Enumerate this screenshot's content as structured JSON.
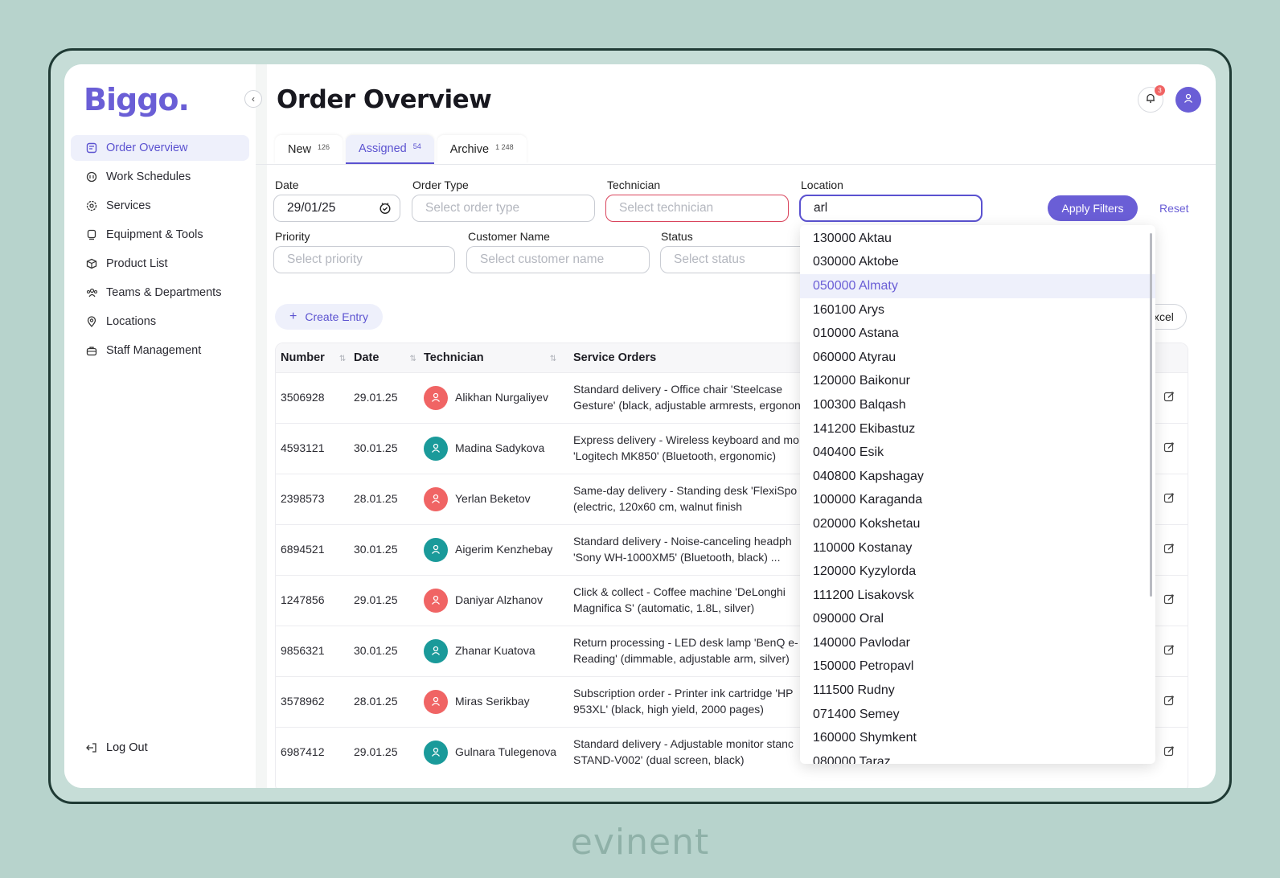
{
  "brand": "Biggo.",
  "page_title": "Order Overview",
  "notifications_count": "3",
  "sidebar": {
    "items": [
      {
        "label": "Order Overview",
        "icon": "document-list-icon"
      },
      {
        "label": "Work Schedules",
        "icon": "calendar-icon"
      },
      {
        "label": "Services",
        "icon": "gear-icon"
      },
      {
        "label": "Equipment & Tools",
        "icon": "device-icon"
      },
      {
        "label": "Product List",
        "icon": "box-icon"
      },
      {
        "label": "Teams & Departments",
        "icon": "team-icon"
      },
      {
        "label": "Locations",
        "icon": "location-pin-icon"
      },
      {
        "label": "Staff Management",
        "icon": "briefcase-icon"
      }
    ],
    "logout": "Log Out"
  },
  "tabs": [
    {
      "label": "New",
      "count": "126"
    },
    {
      "label": "Assigned",
      "count": "54"
    },
    {
      "label": "Archive",
      "count": "1 248"
    }
  ],
  "filters": {
    "date": {
      "label": "Date",
      "value": "29/01/25"
    },
    "order_type": {
      "label": "Order Type",
      "placeholder": "Select order type"
    },
    "technician": {
      "label": "Technician",
      "placeholder": "Select technician"
    },
    "location": {
      "label": "Location",
      "value": "arl"
    },
    "priority": {
      "label": "Priority",
      "placeholder": "Select priority"
    },
    "customer_name": {
      "label": "Customer Name",
      "placeholder": "Select customer name"
    },
    "status": {
      "label": "Status",
      "placeholder": "Select status"
    },
    "apply": "Apply Filters",
    "reset": "Reset"
  },
  "actions": {
    "create": "Create Entry",
    "excel": "xcel"
  },
  "table": {
    "headers": [
      "Number",
      "Date",
      "Technician",
      "Service Orders"
    ],
    "rows": [
      {
        "number": "3506928",
        "date": "29.01.25",
        "technician": "Alikhan Nurgaliyev",
        "line1": "Standard delivery - Office chair 'Steelcase",
        "line2": "Gesture' (black, adjustable armrests, ergonon"
      },
      {
        "number": "4593121",
        "date": "30.01.25",
        "technician": "Madina Sadykova",
        "line1": "Express delivery - Wireless keyboard and mo",
        "line2": "'Logitech MK850' (Bluetooth, ergonomic)"
      },
      {
        "number": "2398573",
        "date": "28.01.25",
        "technician": "Yerlan Beketov",
        "line1": "Same-day delivery - Standing desk 'FlexiSpo",
        "line2": "(electric, 120x60 cm, walnut finish"
      },
      {
        "number": "6894521",
        "date": "30.01.25",
        "technician": "Aigerim Kenzhebay",
        "line1": "Standard delivery - Noise-canceling headph",
        "line2": "'Sony WH-1000XM5' (Bluetooth, black)  ..."
      },
      {
        "number": "1247856",
        "date": "29.01.25",
        "technician": "Daniyar Alzhanov",
        "line1": "Click & collect - Coffee machine 'DeLonghi",
        "line2": "Magnifica S' (automatic, 1.8L, silver)"
      },
      {
        "number": "9856321",
        "date": "30.01.25",
        "technician": "Zhanar Kuatova",
        "line1": "Return processing - LED desk lamp 'BenQ e-",
        "line2": "Reading' (dimmable, adjustable arm, silver)"
      },
      {
        "number": "3578962",
        "date": "28.01.25",
        "technician": "Miras Serikbay",
        "line1": "Subscription order - Printer ink cartridge 'HP",
        "line2": "953XL' (black, high yield, 2000 pages)"
      },
      {
        "number": "6987412",
        "date": "29.01.25",
        "technician": "Gulnara Tulegenova",
        "line1": "Standard delivery - Adjustable monitor stanc",
        "line2": "STAND-V002' (dual screen, black)"
      }
    ]
  },
  "location_options": [
    "130000 Aktau",
    "030000 Aktobe",
    "050000 Almaty",
    "160100 Arys",
    "010000 Astana",
    "060000 Atyrau",
    "120000 Baikonur",
    "100300 Balqash",
    "141200 Ekibastuz",
    "040400 Esik",
    "040800 Kapshagay",
    "100000 Karaganda",
    "020000 Kokshetau",
    "110000 Kostanay",
    "120000 Kyzylorda",
    "111200 Lisakovsk",
    "090000 Oral",
    "140000 Pavlodar",
    "150000 Petropavl",
    "111500 Rudny",
    "071400 Semey",
    "160000 Shymkent",
    "080000 Taraz"
  ],
  "footer_brand": "evinent",
  "colors": {
    "accent": "#6a5ed6",
    "avatar_red": "#f06464",
    "avatar_teal": "#1a9a9a",
    "background": "#b7d3cc"
  }
}
